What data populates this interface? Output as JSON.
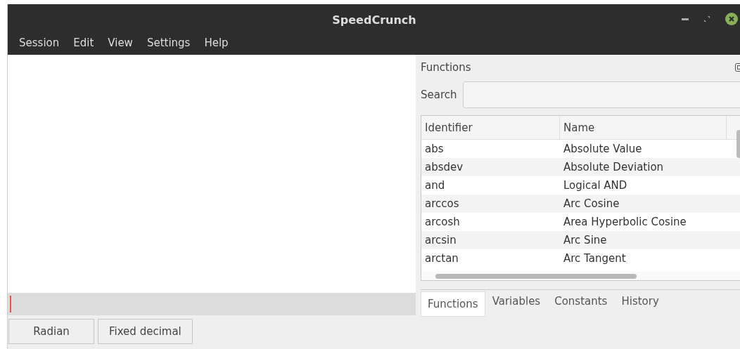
{
  "window": {
    "title": "SpeedCrunch"
  },
  "menu": [
    "Session",
    "Edit",
    "View",
    "Settings",
    "Help"
  ],
  "status_buttons": [
    "Radian",
    "Fixed decimal"
  ],
  "dock": {
    "title": "Functions",
    "search": {
      "label": "Search"
    },
    "table": {
      "columns": [
        "Identifier",
        "Name"
      ],
      "rows": [
        [
          "abs",
          "Absolute Value"
        ],
        [
          "absdev",
          "Absolute Deviation"
        ],
        [
          "and",
          "Logical AND"
        ],
        [
          "arccos",
          "Arc Cosine"
        ],
        [
          "arcosh",
          "Area Hyperbolic Cosine"
        ],
        [
          "arcsin",
          "Arc Sine"
        ],
        [
          "arctan",
          "Arc Tangent"
        ]
      ]
    },
    "tabs": [
      {
        "label": "Functions",
        "selected": true
      },
      {
        "label": "Variables",
        "selected": false
      },
      {
        "label": "Constants",
        "selected": false
      },
      {
        "label": "History",
        "selected": false
      }
    ]
  }
}
